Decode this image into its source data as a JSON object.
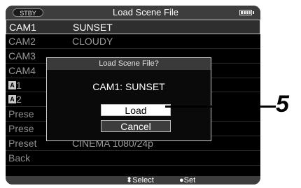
{
  "status": "STBY",
  "title": "Load Scene File",
  "list": [
    {
      "key": "CAM1",
      "value": "SUNSET",
      "selected": true
    },
    {
      "key": "CAM2",
      "value": "CLOUDY"
    },
    {
      "key": "CAM3",
      "value": ""
    },
    {
      "key": "CAM4",
      "value": ""
    },
    {
      "key": "1",
      "badge": "A",
      "value": ""
    },
    {
      "key": "2",
      "badge": "A",
      "value": ""
    },
    {
      "key": "Prese",
      "value": ""
    },
    {
      "key": "Prese",
      "value": ""
    },
    {
      "key": "Preset",
      "value": "CINEMA 1080/24p"
    },
    {
      "key": "Back",
      "value": ""
    }
  ],
  "dialog": {
    "title": "Load Scene File?",
    "message": "CAM1: SUNSET",
    "load_label": "Load",
    "cancel_label": "Cancel"
  },
  "footer": {
    "select_hint": "⬍Select",
    "set_hint": "●Set"
  },
  "callout": "5",
  "colors": {
    "screen_bg": "#000000",
    "bar_bg": "#3d3d3d",
    "selected_border": "#c8c8c8"
  }
}
